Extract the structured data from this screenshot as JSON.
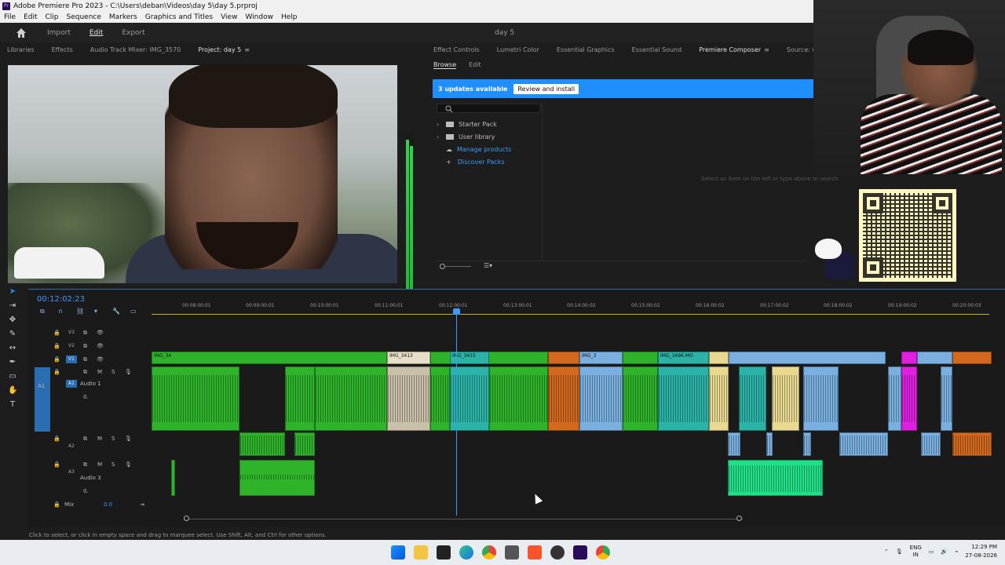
{
  "window": {
    "title": "Adobe Premiere Pro 2023 - C:\\Users\\deban\\Videos\\day 5\\day 5.prproj"
  },
  "menu": [
    "File",
    "Edit",
    "Clip",
    "Sequence",
    "Markers",
    "Graphics and Titles",
    "View",
    "Window",
    "Help"
  ],
  "appbar": {
    "workspaces": [
      "Import",
      "Edit",
      "Export"
    ],
    "active": "Edit",
    "project_name": "day 5"
  },
  "left_tabs": [
    "Libraries",
    "Effects",
    "Audio Track Mixer: IMG_3570",
    "Project: day 5"
  ],
  "right_tabs": [
    "Effect Controls",
    "Lumetri Color",
    "Essential Graphics",
    "Essential Sound",
    "Premiere Composer",
    "Source: (no clips)"
  ],
  "composer": {
    "tabs": [
      "Browse",
      "Edit"
    ],
    "updates_text": "3 updates available",
    "review_button": "Review and install",
    "items": [
      {
        "label": "Starter Pack",
        "link": false
      },
      {
        "label": "User library",
        "link": false
      },
      {
        "label": "Manage products",
        "link": true
      },
      {
        "label": "Discover Packs",
        "link": true
      }
    ],
    "empty_hint": "Select an item on the left or type above to search"
  },
  "timeline": {
    "timecode": "00:12:02:23",
    "ruler": [
      "00:08:00:01",
      "00:09:00:01",
      "00:10:00:01",
      "00:11:00:01",
      "00:12:00:01",
      "00:13:00:01",
      "00:14:00:02",
      "00:15:00:02",
      "00:16:00:02",
      "00:17:00:02",
      "00:18:00:02",
      "00:19:00:02",
      "00:20:00:03"
    ],
    "tracks": {
      "v3": "V3",
      "v2": "V2",
      "v1": "V1",
      "a1": "A1",
      "a1_name": "Audio 1",
      "a2": "A2",
      "a3": "A3",
      "a3_name": "Audio 3",
      "mix": "Mix",
      "mix_value": "0.0",
      "a1_vol": "0.",
      "a3_vol": "0."
    },
    "clip_labels": [
      "IMG_3413",
      "IMG_3415",
      "IMG_3",
      "IMG_3496.MO",
      "IMG_34"
    ]
  },
  "status": {
    "hint": "Click to select, or click in empty space and drag to marquee select. Use Shift, Alt, and Ctrl for other options."
  },
  "tray": {
    "lang": "ENG",
    "region": "IN",
    "time": "12:29 PM",
    "date": "27-08-2026"
  }
}
